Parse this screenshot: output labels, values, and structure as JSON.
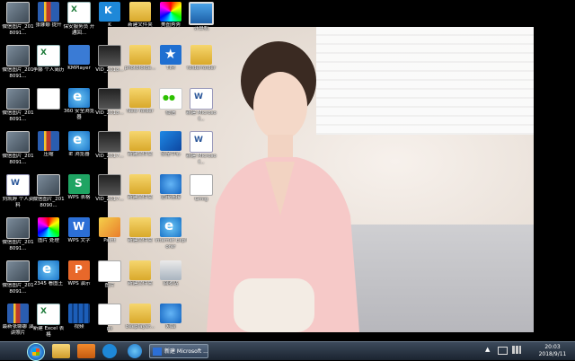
{
  "desktop": {
    "icons": [
      {
        "name": "icon-wechat-photo-1",
        "glyph": "g-photo",
        "label": "微信图片_2018091..."
      },
      {
        "name": "icon-zip-1",
        "glyph": "g-zip",
        "label": "张娜娜 提升"
      },
      {
        "name": "icon-excel-1",
        "glyph": "g-excel",
        "label": "保安服务员 开通回..."
      },
      {
        "name": "icon-k-1",
        "glyph": "g-k",
        "label": "K"
      },
      {
        "name": "icon-folder-1",
        "glyph": "g-folder",
        "label": "新建文件夹"
      },
      {
        "name": "icon-color-1",
        "glyph": "g-color",
        "label": "美图秀秀"
      },
      {
        "name": "icon-computer",
        "glyph": "g-pc",
        "label": "计算机"
      },
      {
        "name": "icon-wechat-photo-2",
        "glyph": "g-photo",
        "label": "微信图片_2018091..."
      },
      {
        "name": "icon-excel-2",
        "glyph": "g-excel",
        "label": "李娜 个人简历"
      },
      {
        "name": "icon-kmplayer",
        "glyph": "g-blue",
        "label": "KMPlayer"
      },
      {
        "name": "icon-vid-1",
        "glyph": "g-video",
        "label": "VID_2018..."
      },
      {
        "name": "icon-photo-folder",
        "glyph": "g-folder",
        "label": "photofolde..."
      },
      {
        "name": "icon-tim",
        "glyph": "g-star",
        "label": "TIM"
      },
      {
        "name": "icon-folder-2",
        "glyph": "g-folder",
        "label": "folderfolder"
      },
      {
        "name": "icon-wechat-photo-3",
        "glyph": "g-photo",
        "label": "微信图片_2018091..."
      },
      {
        "name": "icon-doc-1",
        "glyph": "g-doc",
        "label": ""
      },
      {
        "name": "icon-ie-1",
        "glyph": "g-ie",
        "label": "360 安全浏览器"
      },
      {
        "name": "icon-vid-2",
        "glyph": "g-video",
        "label": "VID_2018..."
      },
      {
        "name": "icon-folder-3",
        "glyph": "g-folder",
        "label": "New folder"
      },
      {
        "name": "icon-wechat",
        "glyph": "g-wechat",
        "label": "微信"
      },
      {
        "name": "icon-word-1",
        "glyph": "g-word",
        "label": "新建 Microsof..."
      },
      {
        "name": "icon-wechat-photo-4",
        "glyph": "g-photo",
        "label": "微信图片_2018091..."
      },
      {
        "name": "icon-zip-2",
        "glyph": "g-zip",
        "label": "压缩"
      },
      {
        "name": "icon-ie-2",
        "glyph": "g-ie",
        "label": "IE 浏览器"
      },
      {
        "name": "icon-vid-3",
        "glyph": "g-video",
        "label": "VID_2017..."
      },
      {
        "name": "icon-folder-4",
        "glyph": "g-folder",
        "label": "新建文件夹"
      },
      {
        "name": "icon-sec-1",
        "glyph": "g-sec",
        "label": "安全中心"
      },
      {
        "name": "icon-word-2",
        "glyph": "g-word",
        "label": "新建 Microsof..."
      },
      {
        "name": "icon-word-3",
        "glyph": "g-word",
        "label": "刘凯婷 个人资料"
      },
      {
        "name": "icon-wechat-photo-5",
        "glyph": "g-photo",
        "label": "微信图片_2018090..."
      },
      {
        "name": "icon-wps-s",
        "glyph": "g-green",
        "label": "WPS 表格"
      },
      {
        "name": "icon-vid-4",
        "glyph": "g-video",
        "label": "VID_2017..."
      },
      {
        "name": "icon-folder-5",
        "glyph": "g-folder",
        "label": "新建文件夹"
      },
      {
        "name": "icon-sec-2",
        "glyph": "g-net",
        "label": "宽带连接"
      },
      {
        "name": "icon-doc-2",
        "glyph": "g-doc",
        "label": "Gmig"
      },
      {
        "name": "icon-wechat-photo-6",
        "glyph": "g-photo",
        "label": "微信图片_2018091..."
      },
      {
        "name": "icon-color-2",
        "glyph": "g-color",
        "label": "图片 处理"
      },
      {
        "name": "icon-wps-w",
        "glyph": "g-wps",
        "label": "WPS 文字"
      },
      {
        "name": "icon-paint",
        "glyph": "g-paint",
        "label": "Paint"
      },
      {
        "name": "icon-folder-6",
        "glyph": "g-folder",
        "label": "新建文件夹"
      },
      {
        "name": "icon-ie-3",
        "glyph": "g-ie",
        "label": "Internet Explorer"
      },
      {
        "name": "icon-empty-1",
        "glyph": "",
        "label": ""
      },
      {
        "name": "icon-wechat-photo-7",
        "glyph": "g-photo",
        "label": "微信图片_2018091..."
      },
      {
        "name": "icon-2345",
        "glyph": "g-ie",
        "label": "2345 看图王"
      },
      {
        "name": "icon-wps-p",
        "glyph": "g-wpsp",
        "label": "WPS 演示"
      },
      {
        "name": "icon-doc-3",
        "glyph": "g-doc",
        "label": "图片"
      },
      {
        "name": "icon-folder-7",
        "glyph": "g-folder",
        "label": "新建文件夹"
      },
      {
        "name": "icon-trash",
        "glyph": "g-trash",
        "label": "回收站"
      },
      {
        "name": "icon-empty-2",
        "glyph": "",
        "label": ""
      },
      {
        "name": "icon-zip-3",
        "glyph": "g-zip",
        "label": "最新张娜娜 演讲照片"
      },
      {
        "name": "icon-excel-3",
        "glyph": "g-excel",
        "label": "新建 Excel 表格"
      },
      {
        "name": "icon-film",
        "glyph": "g-film",
        "label": "视频"
      },
      {
        "name": "icon-ps",
        "glyph": "g-ps",
        "label": "ps"
      },
      {
        "name": "icon-folder-8",
        "glyph": "g-folder",
        "label": "beeplayer..."
      },
      {
        "name": "icon-network",
        "glyph": "g-net",
        "label": "网络"
      },
      {
        "name": "icon-empty-3",
        "glyph": "",
        "label": ""
      }
    ]
  },
  "taskbar": {
    "task_label": "新建 Microsoft ...",
    "clock_time": "20:03",
    "clock_date": "2018/9/11"
  }
}
